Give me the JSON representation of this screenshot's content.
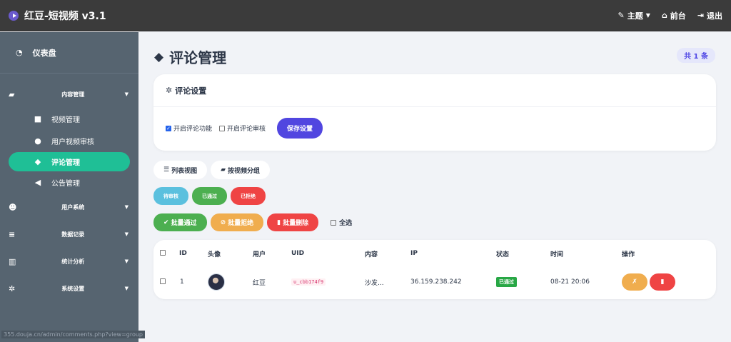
{
  "topbar": {
    "brand": "红豆-短视频 v3.1",
    "theme_label": "主题",
    "front_label": "前台",
    "logout_label": "退出"
  },
  "sidebar": {
    "dashboard": "仪表盘",
    "groups": {
      "content": "内容管理",
      "users": "用户系统",
      "data": "数据记录",
      "stats": "统计分析",
      "settings": "系统设置"
    },
    "items": {
      "videos": "视频管理",
      "user_review": "用户视频审核",
      "comments": "评论管理",
      "notices": "公告管理"
    }
  },
  "status_url": "355.douja.cn/admin/comments.php?view=group",
  "page": {
    "title": "评论管理",
    "count_badge": "共 1 条"
  },
  "settings": {
    "title": "评论设置",
    "enable_comments": "开启评论功能",
    "enable_review": "开启评论审核",
    "enable_comments_checked": true,
    "enable_review_checked": false,
    "save_label": "保存设置"
  },
  "views": {
    "list": "列表视图",
    "group": "按视频分组"
  },
  "filters": {
    "pending": "待审核",
    "approved": "已通过",
    "rejected": "已拒绝"
  },
  "bulk": {
    "approve": "批量通过",
    "reject": "批量拒绝",
    "delete": "批量删除",
    "select_all": "全选"
  },
  "table": {
    "headers": [
      "ID",
      "头像",
      "用户",
      "UID",
      "内容",
      "IP",
      "状态",
      "时间",
      "操作"
    ],
    "rows": [
      {
        "id": "1",
        "user": "红豆",
        "uid": "u_cbb174f9",
        "content": "沙发...",
        "ip": "36.159.238.242",
        "status": "已通过",
        "time": "08-21 20:06",
        "reject_glyph": "✗"
      }
    ]
  },
  "colors": {
    "sidebar_bg": "#566470",
    "active_item": "#1fbf96",
    "primary": "#5146e0",
    "pending": "#5bc0de",
    "approved": "#4caf50",
    "rejected": "#ef4444",
    "warning": "#f0ad4e"
  }
}
